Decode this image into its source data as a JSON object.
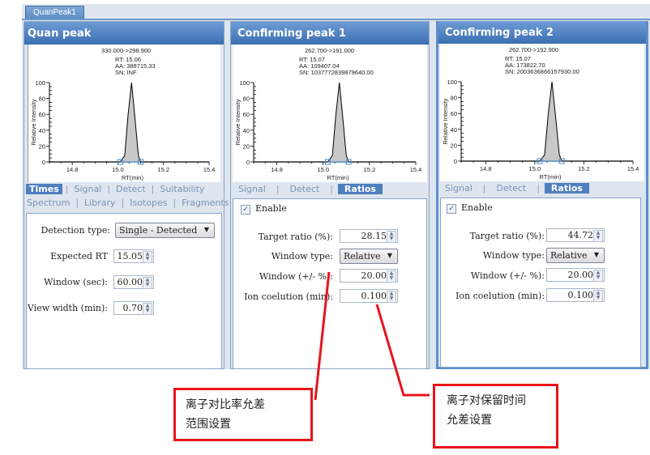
{
  "document_tab": "QuanPeak1",
  "panels": [
    {
      "title": "Quan peak",
      "chart": {
        "transition": "330.000->298.900",
        "rt": "RT: 15.06",
        "aa": "AA: 388715.33",
        "sn": "SN: INF"
      },
      "tabs_row1": [
        "Times",
        "Signal",
        "Detect",
        "Suitability"
      ],
      "tabs_row2": [
        "Spectrum",
        "Library",
        "Isotopes",
        "Fragments"
      ],
      "active_tab": "Times",
      "form": {
        "detection_type_label": "Detection type:",
        "detection_type_value": "Single - Detected",
        "expected_rt_label": "Expected RT",
        "expected_rt_value": "15.05",
        "window_label": "Window (sec):",
        "window_value": "60.00",
        "view_width_label": "View width (min):",
        "view_width_value": "0.70"
      }
    },
    {
      "title": "Confirming peak 1",
      "chart": {
        "transition": "262.700->191.000",
        "rt": "RT: 15.07",
        "aa": "AA: 109407.04",
        "sn": "SN: 1037772839879640.00"
      },
      "tabs": [
        "Signal",
        "Detect",
        "Ratios"
      ],
      "active_tab": "Ratios",
      "form": {
        "enable_label": "Enable",
        "enable_checked": true,
        "target_ratio_label": "Target ratio (%):",
        "target_ratio_value": "28.15",
        "window_type_label": "Window type:",
        "window_type_value": "Relative",
        "window_pct_label": "Window (+/- %):",
        "window_pct_value": "20.00",
        "ion_coelution_label": "Ion coelution (min):",
        "ion_coelution_value": "0.100"
      }
    },
    {
      "title": "Confirming peak 2",
      "chart": {
        "transition": "262.700->192.900",
        "rt": "RT: 15.07",
        "aa": "AA: 173822.70",
        "sn": "SN: 2003636866157930.00"
      },
      "tabs": [
        "Signal",
        "Detect",
        "Ratios"
      ],
      "active_tab": "Ratios",
      "form": {
        "enable_label": "Enable",
        "enable_checked": true,
        "target_ratio_label": "Target ratio (%):",
        "target_ratio_value": "44.72",
        "window_type_label": "Window type:",
        "window_type_value": "Relative",
        "window_pct_label": "Window (+/- %):",
        "window_pct_value": "20.00",
        "ion_coelution_label": "Ion coelution (min):",
        "ion_coelution_value": "0.100"
      }
    }
  ],
  "chart_data": [
    {
      "type": "line",
      "title": "330.000->298.900",
      "xlabel": "RT(min)",
      "ylabel": "Relative Intensity",
      "xlim": [
        14.7,
        15.4
      ],
      "ylim": [
        0,
        100
      ],
      "xticks": [
        "14.8",
        "15.0",
        "15.2",
        "15.4"
      ],
      "yticks": [
        "0",
        "20",
        "40",
        "60",
        "80",
        "100"
      ],
      "x": [
        15.01,
        15.03,
        15.045,
        15.06,
        15.075,
        15.09,
        15.1
      ],
      "y": [
        0,
        8,
        60,
        100,
        55,
        8,
        0
      ],
      "peak_boundaries": [
        15.01,
        15.1
      ],
      "annotations": [
        "RT: 15.06",
        "AA: 388715.33",
        "SN: INF"
      ]
    },
    {
      "type": "line",
      "title": "262.700->191.000",
      "xlabel": "RT(min)",
      "ylabel": "Relative Intensity",
      "xlim": [
        14.7,
        15.4
      ],
      "ylim": [
        0,
        100
      ],
      "xticks": [
        "14.8",
        "15.0",
        "15.2",
        "15.4"
      ],
      "yticks": [
        "0",
        "20",
        "40",
        "60",
        "80",
        "100"
      ],
      "x": [
        15.02,
        15.04,
        15.055,
        15.07,
        15.085,
        15.1,
        15.11
      ],
      "y": [
        0,
        8,
        60,
        100,
        55,
        8,
        0
      ],
      "peak_boundaries": [
        15.02,
        15.11
      ],
      "annotations": [
        "RT: 15.07",
        "AA: 109407.04",
        "SN: 1037772839879640.00"
      ]
    },
    {
      "type": "line",
      "title": "262.700->192.900",
      "xlabel": "RT(min)",
      "ylabel": "Relative Intensity",
      "xlim": [
        14.7,
        15.4
      ],
      "ylim": [
        0,
        100
      ],
      "xticks": [
        "14.8",
        "15.0",
        "15.2",
        "15.4"
      ],
      "yticks": [
        "0",
        "20",
        "40",
        "60",
        "80",
        "100"
      ],
      "x": [
        15.02,
        15.04,
        15.055,
        15.07,
        15.085,
        15.1,
        15.11
      ],
      "y": [
        0,
        8,
        60,
        100,
        55,
        8,
        0
      ],
      "peak_boundaries": [
        15.02,
        15.11
      ],
      "annotations": [
        "RT: 15.07",
        "AA: 173822.70",
        "SN: 2003636866157930.00"
      ]
    }
  ],
  "annotations": {
    "ratio_tolerance": [
      "离子对比率允差",
      "范围设置"
    ],
    "rt_tolerance": [
      "离子对保留时间",
      "允差设置"
    ],
    "color": "#e8141b"
  },
  "colors": {
    "accent": "#4f7fbf",
    "panel_bg": "#dfe5ee",
    "peak_fill": "#c8c8c8"
  }
}
